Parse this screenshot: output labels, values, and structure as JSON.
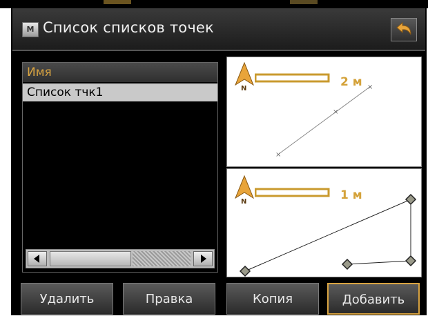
{
  "window": {
    "title": "Список списков точек",
    "mode_icon_letter": "M"
  },
  "list": {
    "header": "Имя",
    "rows": [
      "Список тчк1"
    ]
  },
  "maps": [
    {
      "scale_label": "2 м",
      "north_label": "N"
    },
    {
      "scale_label": "1 м",
      "north_label": "N"
    }
  ],
  "buttons": {
    "delete": "Удалить",
    "edit": "Правка",
    "copy": "Копия",
    "add": "Добавить"
  },
  "colors": {
    "accent": "#d9a441",
    "background": "#000000",
    "selected_row": "#c9c9c9"
  },
  "icons": {
    "back": "back-arrow-icon",
    "north": "north-arrow-icon"
  }
}
